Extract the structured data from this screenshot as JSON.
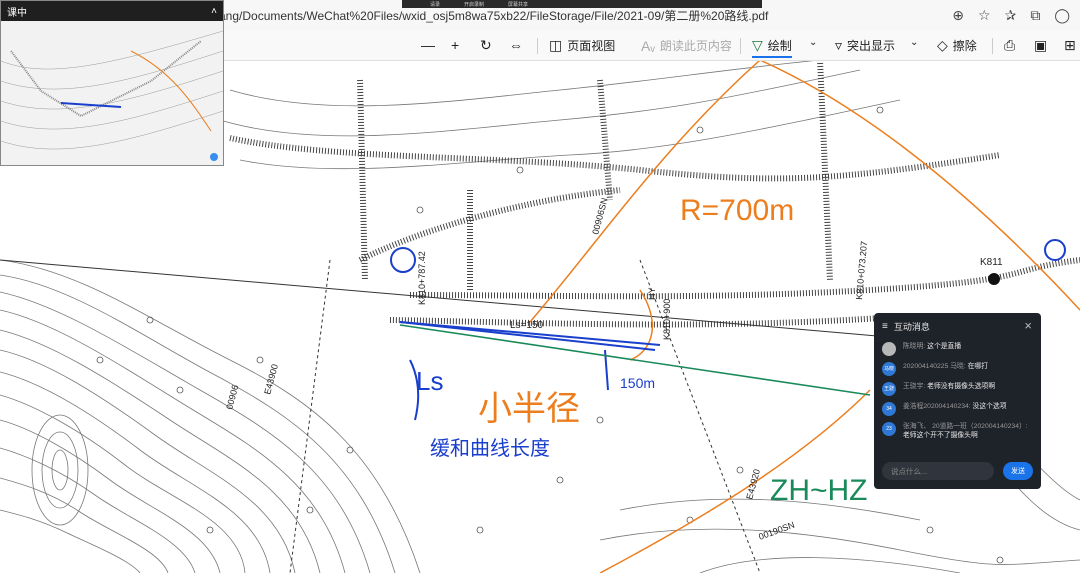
{
  "meeting_bar": {
    "items": [
      "请录",
      "开启录制",
      "屏幕共享"
    ]
  },
  "browser": {
    "url": "ang/Documents/WeChat%20Files/wxid_osj5m8wa75xb22/FileStorage/File/2021-09/第二册%20路线.pdf",
    "icons": [
      "zoom-icon",
      "favorite-add-icon",
      "favorites-icon",
      "collections-icon",
      "profile-icon"
    ]
  },
  "pdf_toolbar": {
    "zoom_out": "—",
    "zoom_in": "+",
    "page_view": "页面视图",
    "read_aloud": "朗读此页内容",
    "draw": "绘制",
    "highlight": "突出显示",
    "erase": "擦除"
  },
  "thumbnail": {
    "title": "课中",
    "collapse": "˄"
  },
  "map_labels": {
    "radius_note": "R=700m",
    "ls_note": "Ls=150",
    "small_curve_note": "小半径",
    "ls_len": "150m",
    "blue_note": "Ls",
    "blue_note2": "缓和曲线长度",
    "green_note": "ZH~HZ",
    "station_k811": "K811",
    "station_ls": "Ls=150",
    "station_k810": "K810+787.42",
    "station_pile": "K810+900",
    "station_hy": "HY",
    "coord_1": "00906",
    "coord_2": "00906SN",
    "coord_3": "E43900",
    "coord_4": "00190SN",
    "coord_5": "E43920",
    "coord_6": "K810+073.207"
  },
  "chat": {
    "title": "互动消息",
    "messages": [
      {
        "avatar": "",
        "name": "陈晓明:",
        "text": " 这个是直播"
      },
      {
        "avatar": "马晓",
        "name": "202004140225 马晓:",
        "text": " 在哪打"
      },
      {
        "avatar": "王骁",
        "name": "王骁宇:",
        "text": " 老师没有摄像头选项啊"
      },
      {
        "avatar": "34",
        "name": "姜浩程202004140234:",
        "text": " 没这个选项"
      },
      {
        "avatar": "23",
        "name": "张海飞、 20道路一班（202004140234）:",
        "text": "老师这个开不了摄像头啊"
      }
    ],
    "input_placeholder": "说点什么...",
    "send": "发送"
  }
}
